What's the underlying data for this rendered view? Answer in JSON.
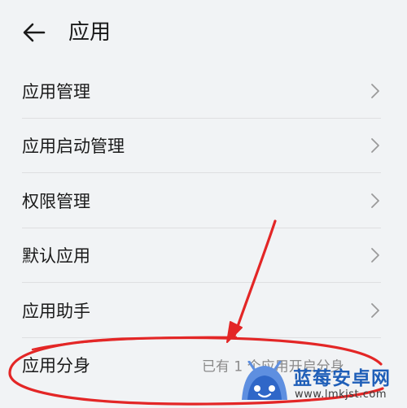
{
  "header": {
    "title": "应用"
  },
  "list": {
    "items": [
      {
        "label": "应用管理"
      },
      {
        "label": "应用启动管理"
      },
      {
        "label": "权限管理"
      },
      {
        "label": "默认应用"
      },
      {
        "label": "应用助手"
      },
      {
        "label": "应用分身",
        "subtitle": "已有 1 个应用开启分身"
      }
    ]
  },
  "watermark": {
    "brand": "蓝莓安卓网",
    "url": "www.lmkjst.com"
  },
  "colors": {
    "background": "#f1f3f5",
    "divider": "#dedfe1",
    "annotation": "#e32626",
    "watermark_blue": "#1f5fb8"
  }
}
